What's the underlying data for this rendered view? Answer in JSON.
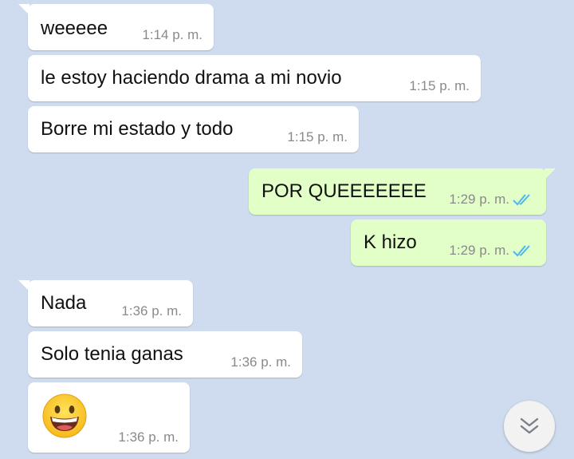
{
  "messages": [
    {
      "text": "weeeee",
      "time": "1:14 p. m."
    },
    {
      "text": "le estoy haciendo drama a mi novio",
      "time": "1:15 p. m."
    },
    {
      "text": "Borre mi estado y todo",
      "time": "1:15 p. m."
    },
    {
      "text": "POR QUEEEEEEE",
      "time": "1:29 p. m.",
      "status": "read"
    },
    {
      "text": "K hizo",
      "time": "1:29 p. m.",
      "status": "read"
    },
    {
      "text": "Nada",
      "time": "1:36 p. m."
    },
    {
      "text": "Solo tenia ganas",
      "time": "1:36 p. m."
    },
    {
      "emoji": "grinning-face",
      "time": "1:36 p. m."
    }
  ],
  "colors": {
    "background": "#cfdcef",
    "incoming": "#ffffff",
    "outgoing": "#e1ffc7",
    "read_check": "#4fb6ec"
  },
  "icons": {
    "read": "double-check-icon",
    "scroll": "double-chevron-down-icon"
  }
}
